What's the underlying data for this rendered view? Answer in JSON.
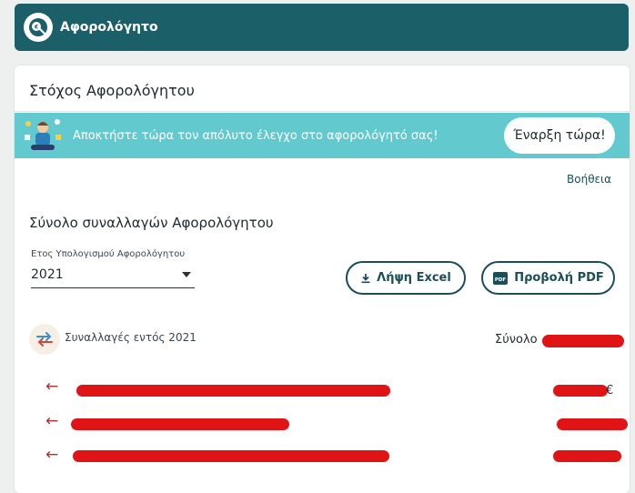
{
  "header": {
    "title": "Αφορολόγητο"
  },
  "card": {
    "title": "Στόχος Αφορολόγητου",
    "banner": {
      "text": "Αποκτήστε τώρα τον απόλυτο έλεγχο στο αφορολόγητό σας!",
      "button_label": "Έναρξη τώρα!"
    },
    "help_label": "Βοήθεια",
    "section_title": "Σύνολο συναλλαγών Αφορολόγητου",
    "year_field": {
      "label": "Ετος Υπολογισμού Αφορολόγητου",
      "value": "2021"
    },
    "actions": {
      "excel_label": "Λήψη Excel",
      "pdf_label": "Προβολή PDF",
      "pdf_badge": "PDF"
    },
    "summary": {
      "text": "Συναλλαγές εντός 2021",
      "total_label": "Σύνολο"
    },
    "rows": [
      {
        "arrow": "←",
        "tail": "€"
      },
      {
        "arrow": "←",
        "tail": ""
      },
      {
        "arrow": "←",
        "tail": ""
      }
    ]
  },
  "colors": {
    "header_bg": "#1b5f68",
    "banner_bg": "#62c9cf",
    "accent": "#1b4f58",
    "redaction": "#e01414"
  },
  "icons": [
    "logo-icon",
    "banner-figure-icon",
    "download-icon",
    "pdf-icon",
    "transfer-arrows-icon",
    "arrow-left-icon"
  ]
}
